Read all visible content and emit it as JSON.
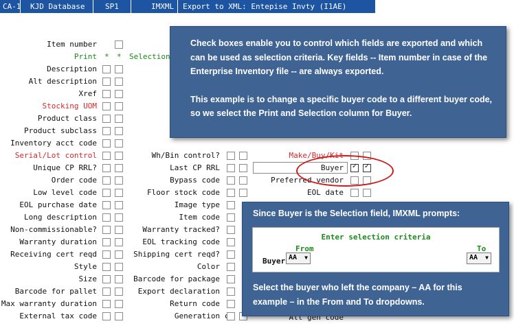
{
  "titlebar": {
    "cells": [
      "CA-1",
      "KJD Database",
      "SP1",
      "IMXML",
      "Export to XML: Entepise Invty (I1AE)"
    ]
  },
  "header": {
    "print": "Print",
    "star1": "*",
    "star2": "*",
    "selection": "Selection"
  },
  "fields": {
    "item_number": "Item number",
    "description": "Description",
    "alt_description": "Alt description",
    "xref": "Xref",
    "stocking_uom": "Stocking UOM",
    "product_class": "Product class",
    "product_subclass": "Product subclass",
    "inventory_acct_code": "Inventory acct code",
    "serial_lot_control": "Serial/Lot control",
    "unique_cp_rrl": "Unique CP RRL?",
    "order_code": "Order code",
    "low_level_code": "Low level code",
    "eol_purchase_date": "EOL purchase date",
    "long_description": "Long description",
    "non_commissionable": "Non-commissionable?",
    "warranty_duration": "Warranty duration",
    "receiving_cert_reqd": "Receiving cert reqd",
    "style": "Style",
    "size": "Size",
    "barcode_for_pallet": "Barcode for pallet",
    "max_warranty_duration": "Max warranty duration",
    "external_tax_code": "External tax code",
    "wh_bin_control": "Wh/Bin control?",
    "last_cp_rrl": "Last CP RRL",
    "bypass_code": "Bypass code",
    "floor_stock_code": "Floor stock code",
    "image_type": "Image type",
    "item_code": "Item code",
    "warranty_tracked": "Warranty tracked?",
    "eol_tracking_code": "EOL tracking code",
    "shipping_cert_reqd": "Shipping cert reqd?",
    "color": "Color",
    "barcode_for_package": "Barcode for package",
    "export_declaration": "Export declaration",
    "return_code": "Return code",
    "generation_cd": "Generation cd",
    "make_buy_kit": "Make/Buy/Kit",
    "buyer": "Buyer",
    "preferred_vendor": "Preferred vendor",
    "eol_date": "EOL date",
    "alt_gen_code": "Alt gen code"
  },
  "callout_top": {
    "para1": "Check boxes enable you to control which fields are exported and which can be used as selection criteria. Key fields -- Item number in case of the Enterprise Inventory file -- are always exported.",
    "para2": "This example is to change a specific buyer code to a different buyer code, so we select the Print and Selection column for Buyer."
  },
  "callout_bottom": {
    "intro": "Since Buyer is the Selection field, IMXML prompts:",
    "prompt_title": "Enter selection criteria",
    "from_label": "From",
    "to_label": "To",
    "buyer_label": "Buyer",
    "from_value": "AA",
    "to_value": "AA",
    "outro": "Select the buyer who left the company – AA for this example – in the From and To dropdowns."
  },
  "colors": {
    "titlebar_bg": "#1d55a3",
    "callout_bg": "#3f6494",
    "highlight_ellipse": "#d0191b",
    "required_label": "#d42a2a",
    "header_label": "#1a8a1a",
    "prompt_title": "#1a8a1a"
  }
}
